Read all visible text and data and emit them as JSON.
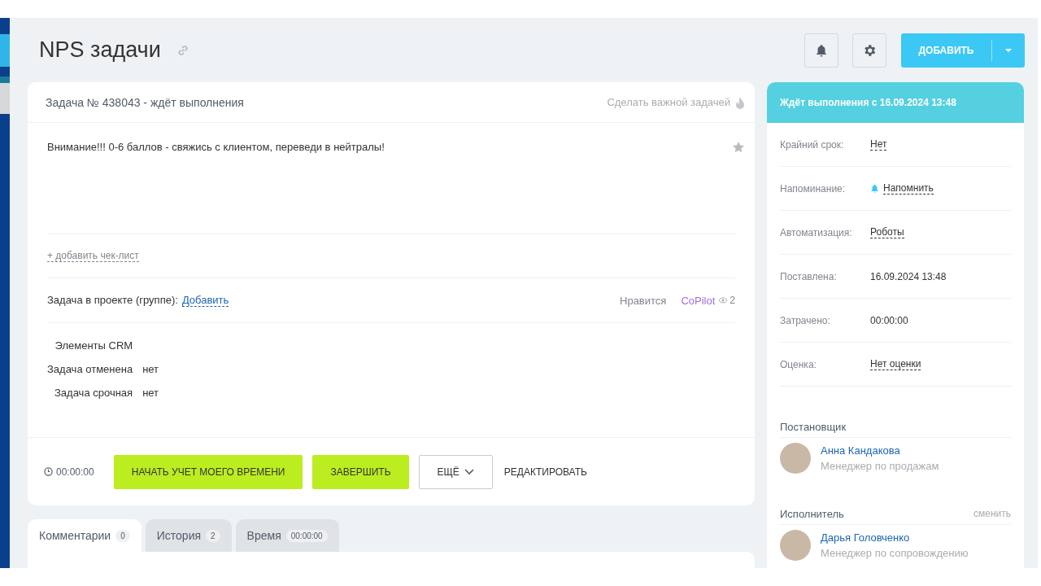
{
  "page": {
    "title": "NPS задачи"
  },
  "toolbar": {
    "add_button": "ДОБАВИТЬ"
  },
  "task": {
    "header": "Задача № 438043 - ждёт выполнения",
    "make_important": "Сделать важной задачей",
    "description": "Внимание!!! 0-6 баллов - свяжись с клиентом, переведи в нейтралы!",
    "add_checklist": "+ добавить чек-лист",
    "project_label": "Задача в проекте (группе):",
    "project_link": "Добавить",
    "like": "Нравится",
    "copilot": "CoPilot",
    "views": "2",
    "fields": [
      {
        "label": "Элементы CRM"
      },
      {
        "label": "Задача отменена",
        "value": "нет"
      },
      {
        "label": "Задача срочная",
        "value": "нет"
      }
    ],
    "timer": "00:00:00",
    "buttons": [
      {
        "label": "НАЧАТЬ УЧЕТ МОЕГО ВРЕМЕНИ",
        "kind": "primary"
      },
      {
        "label": "ЗАВЕРШИТЬ",
        "kind": "primary"
      },
      {
        "label": "ЕЩЁ",
        "kind": "dropdown"
      },
      {
        "label": "РЕДАКТИРОВАТЬ",
        "kind": "link"
      }
    ]
  },
  "tabs": [
    {
      "label": "Комментарии",
      "count": "0",
      "selected": true
    },
    {
      "label": "История",
      "count": "2",
      "selected": false
    },
    {
      "label": "Время",
      "count": "00:00:00",
      "selected": false
    }
  ],
  "sidebar": {
    "status": "Ждёт выполнения с 16.09.2024 13:48",
    "rows": [
      {
        "label": "Крайний срок:",
        "value": "Нет",
        "kind": "link"
      },
      {
        "label": "Напоминание:",
        "value": "Напомнить",
        "kind": "bell"
      },
      {
        "label": "Автоматизация:",
        "value": "Роботы",
        "kind": "link"
      },
      {
        "label": "Поставлена:",
        "value": "16.09.2024 13:48",
        "kind": "plain"
      },
      {
        "label": "Затрачено:",
        "value": "00:00:00",
        "kind": "plain"
      },
      {
        "label": "Оценка:",
        "value": "Нет оценки",
        "kind": "link"
      }
    ],
    "people": [
      {
        "role": "Постановщик",
        "name": "Анна Кандакова",
        "position": "Менеджер по продажам"
      },
      {
        "role": "Исполнитель",
        "action": "сменить",
        "name": "Дарья Головченко",
        "position": "Менеджер по сопровождению"
      }
    ]
  }
}
